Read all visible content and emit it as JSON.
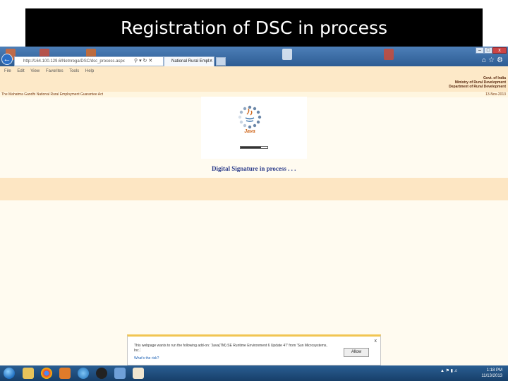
{
  "slide": {
    "title": "Registration of DSC in process"
  },
  "browser": {
    "address_url": "http://164.100.129.6/Netnrega/DSC/dsc_process.aspx",
    "tab_title": "National Rural Empl...",
    "tab_close": "×",
    "menu": [
      "File",
      "Edit",
      "View",
      "Favorites",
      "Tools",
      "Help"
    ],
    "window_controls": {
      "minimize": "–",
      "maximize": "□",
      "close": "x"
    }
  },
  "page": {
    "gov_lines": [
      "Govt. of India",
      "Ministry of Rural Development",
      "Department of Rural Development"
    ],
    "site_name": "The Mahatma Gandhi National Rural Employment Guarantee Act",
    "date": "13-Nov-2013",
    "java_logo_text": "Java",
    "progress": 0.75,
    "status_message": "Digital Signature in process . . ."
  },
  "notification": {
    "message": "This webpage wants to run the following add-on: 'Java(TM) SE Runtime Environment 6 Update 47' from 'Sun Microsystems, Inc.'.",
    "link": "What's the risk?",
    "allow_label": "Allow",
    "close": "x"
  },
  "taskbar": {
    "time": "1:18 PM",
    "date": "11/13/2013"
  },
  "colors": {
    "title_bg": "#000000",
    "page_bg": "#fffbf0",
    "band": "#fde6c3",
    "status_text": "#2c3c8a",
    "taskbar": "#1e4a7a"
  }
}
